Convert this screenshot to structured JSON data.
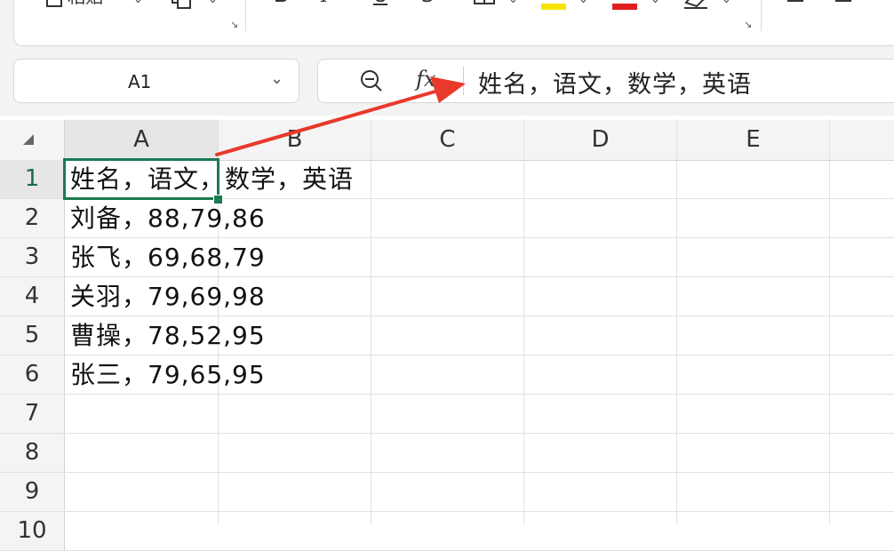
{
  "ribbon": {
    "items": [
      {
        "icon": "clipboard-icon",
        "label": "粘贴"
      },
      {
        "icon": "format-painter-icon"
      },
      {
        "icon": "bold-icon",
        "glyph": "B"
      },
      {
        "icon": "italic-icon",
        "glyph": "I"
      },
      {
        "icon": "underline-icon",
        "glyph": "U"
      },
      {
        "icon": "strikethrough-icon",
        "glyph": "S"
      },
      {
        "icon": "borders-icon"
      },
      {
        "icon": "fill-color-icon",
        "color": "#f5e600"
      },
      {
        "icon": "font-color-icon",
        "glyph": "A",
        "color": "#e02020"
      },
      {
        "icon": "clear-format-icon"
      },
      {
        "icon": "align-left-icon"
      },
      {
        "icon": "align-center-icon"
      }
    ]
  },
  "name_box": {
    "value": "A1"
  },
  "formula_bar": {
    "fx_label": "fx",
    "value": "姓名，语文，数学，英语"
  },
  "sheet": {
    "columns": [
      "A",
      "B",
      "C",
      "D",
      "E"
    ],
    "rows": [
      {
        "num": "1",
        "a": "姓名，语文，数学，英语"
      },
      {
        "num": "2",
        "a": "刘备，88,79,86"
      },
      {
        "num": "3",
        "a": "张飞，69,68,79"
      },
      {
        "num": "4",
        "a": "关羽，79,69,98"
      },
      {
        "num": "5",
        "a": "曹操，78,52,95"
      },
      {
        "num": "6",
        "a": "张三，79,65,95"
      },
      {
        "num": "7",
        "a": ""
      },
      {
        "num": "8",
        "a": ""
      },
      {
        "num": "9",
        "a": ""
      },
      {
        "num": "10",
        "a": ""
      }
    ],
    "selected_cell": "A1"
  },
  "colors": {
    "selection": "#1a7a52",
    "annotation_arrow": "#e8392b"
  }
}
